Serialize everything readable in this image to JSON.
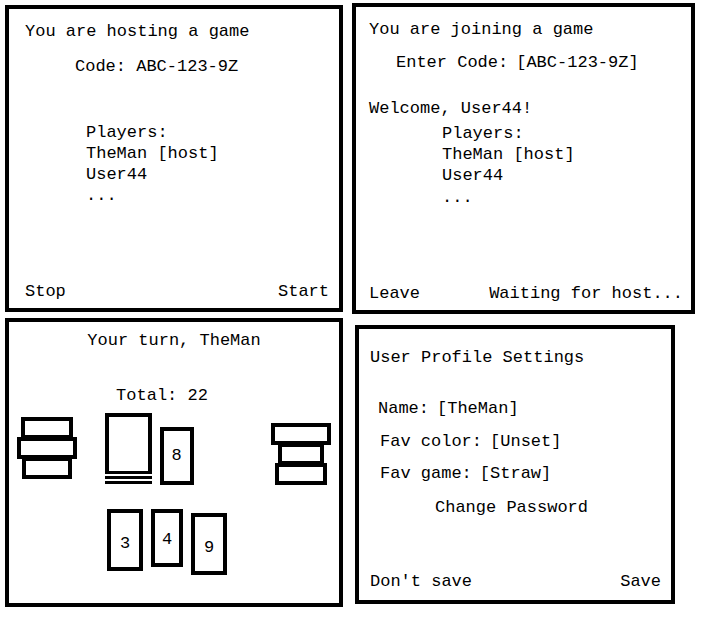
{
  "host": {
    "title": "You are hosting a game",
    "code": "Code: ABC-123-9Z",
    "players_label": "Players:",
    "players": [
      "TheMan [host]",
      "User44",
      "..."
    ],
    "stop_button": "Stop",
    "start_button": "Start"
  },
  "join": {
    "title": "You are joining a game",
    "code_label": "Enter Code:",
    "code_value": "[ABC-123-9Z]",
    "welcome": "Welcome, User44!",
    "players_label": "Players:",
    "players": [
      "TheMan [host]",
      "User44",
      "..."
    ],
    "leave_button": "Leave",
    "status": "Waiting for host..."
  },
  "game": {
    "turn": "Your turn, TheMan",
    "total": "Total: 22",
    "table_card": "8",
    "hand": [
      "3",
      "4",
      "9"
    ]
  },
  "profile": {
    "title": "User Profile Settings",
    "fields": [
      {
        "label": "Name:",
        "value": "[TheMan]"
      },
      {
        "label": "Fav color:",
        "value": "[Unset]"
      },
      {
        "label": "Fav game:",
        "value": "[Straw]"
      }
    ],
    "change_password": "Change Password",
    "dont_save_button": "Don't save",
    "save_button": "Save"
  }
}
